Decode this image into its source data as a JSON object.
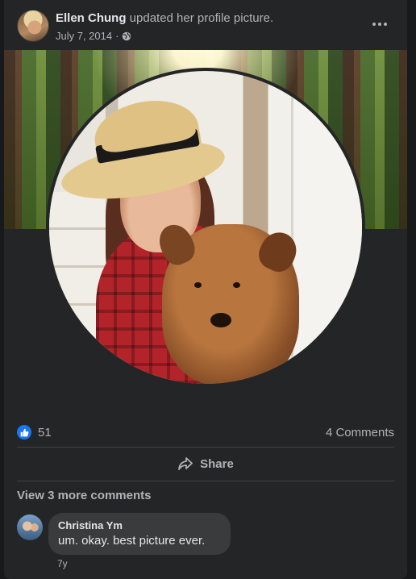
{
  "post": {
    "author": "Ellen Chung",
    "action": "updated her profile picture.",
    "date": "July 7, 2014",
    "separator": "·",
    "privacy_icon": "globe-icon",
    "more_icon": "more-options-icon"
  },
  "reactions": {
    "icon": "like-icon",
    "count": "51",
    "comments_label": "4 Comments"
  },
  "actions": {
    "share_icon": "share-arrow-icon",
    "share_label": "Share"
  },
  "comments": {
    "view_more_label": "View 3 more comments",
    "items": [
      {
        "name": "Christina Ym",
        "text": "um. okay. best picture ever.",
        "time": "7y"
      }
    ]
  },
  "colors": {
    "background": "#18191a",
    "card": "#242526",
    "bubble": "#3a3b3c",
    "primary_text": "#e4e6eb",
    "secondary_text": "#b0b3b8",
    "like_blue": "#1877f2"
  }
}
